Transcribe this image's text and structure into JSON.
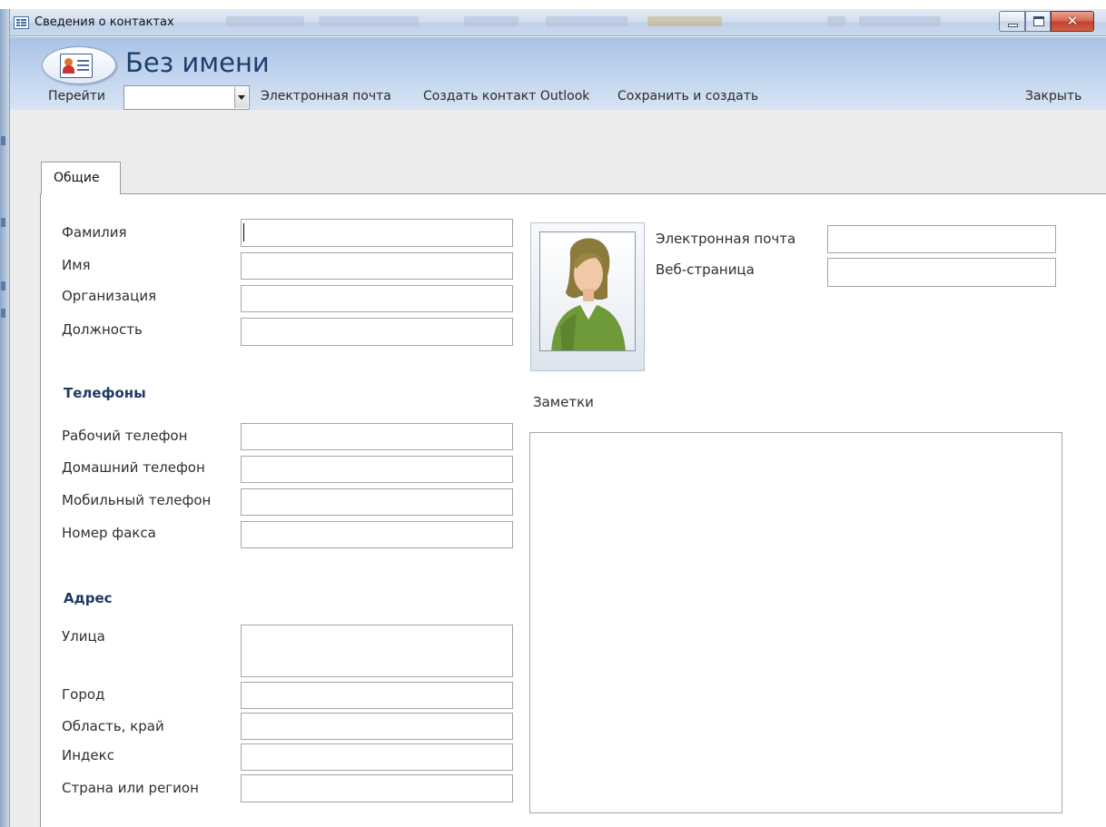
{
  "window": {
    "title": "Сведения о контактах"
  },
  "header": {
    "form_title": "Без имени"
  },
  "commands": {
    "goto_label": "Перейти",
    "goto_value": "",
    "email_label": "Электронная почта",
    "create_outlook_label": "Создать контакт Outlook",
    "save_new_label": "Сохранить и создать",
    "close_label": "Закрыть"
  },
  "tabs": [
    {
      "label": "Общие",
      "active": true
    }
  ],
  "fields": {
    "last_name": {
      "label": "Фамилия",
      "value": ""
    },
    "first_name": {
      "label": "Имя",
      "value": ""
    },
    "company": {
      "label": "Организация",
      "value": ""
    },
    "job_title": {
      "label": "Должность",
      "value": ""
    },
    "phones_heading": "Телефоны",
    "business_phone": {
      "label": "Рабочий телефон",
      "value": ""
    },
    "home_phone": {
      "label": "Домашний телефон",
      "value": ""
    },
    "mobile_phone": {
      "label": "Мобильный телефон",
      "value": ""
    },
    "fax_number": {
      "label": "Номер факса",
      "value": ""
    },
    "address_heading": "Адрес",
    "street": {
      "label": "Улица",
      "value": ""
    },
    "city": {
      "label": "Город",
      "value": ""
    },
    "state": {
      "label": "Область, край",
      "value": ""
    },
    "zip": {
      "label": "Индекс",
      "value": ""
    },
    "country": {
      "label": "Страна или регион",
      "value": ""
    },
    "email": {
      "label": "Электронная почта",
      "value": ""
    },
    "web_page": {
      "label": "Веб-страница",
      "value": ""
    },
    "notes": {
      "label": "Заметки",
      "value": ""
    }
  },
  "colors": {
    "header_title": "#1e3f6e",
    "section_heading": "#1f3a68",
    "close_button": "#c2412b"
  },
  "icons": [
    "form-icon",
    "contact-card-icon",
    "person-photo-icon",
    "minimize-icon",
    "maximize-icon",
    "close-icon",
    "dropdown-arrow-icon"
  ]
}
